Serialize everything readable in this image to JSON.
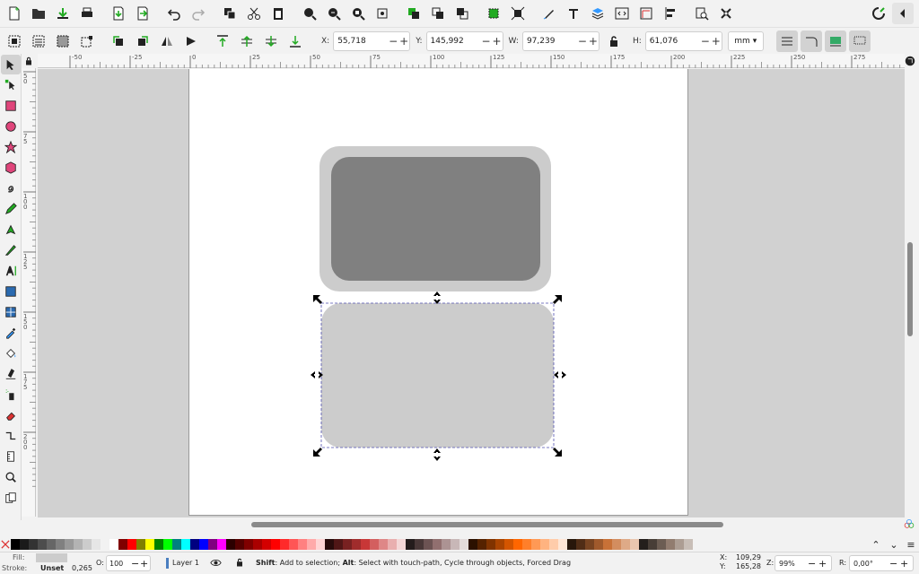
{
  "toolbar2": {
    "x_label": "X:",
    "x_value": "55,718",
    "y_label": "Y:",
    "y_value": "145,992",
    "w_label": "W:",
    "w_value": "97,239",
    "h_label": "H:",
    "h_value": "61,076",
    "unit": "mm"
  },
  "ruler": {
    "h_ticks": [
      "-50",
      "-25",
      "0",
      "25",
      "50",
      "75",
      "100",
      "125",
      "150",
      "175",
      "200",
      "225",
      "250",
      "275"
    ],
    "v_ticks": [
      "50",
      "75",
      "100",
      "125",
      "150",
      "175",
      "200"
    ]
  },
  "status": {
    "fill_label": "Fill:",
    "stroke_label": "Stroke:",
    "stroke_value": "Unset",
    "stroke_width": "0,265",
    "opacity_label": "O:",
    "opacity_value": "100",
    "layer": "Layer 1",
    "message_shift": "Shift",
    "message_1": ": Add to selection; ",
    "message_alt": "Alt",
    "message_2": ": Select with touch-path, Cycle through objects, Forced Drag",
    "cursor_x_label": "X:",
    "cursor_x": "109,29",
    "cursor_y_label": "Y:",
    "cursor_y": "165,28",
    "zoom_label": "Z:",
    "zoom": "99%",
    "rotation_label": "R:",
    "rotation": "0,00°"
  },
  "colors": {
    "accent_pink": "#e0457b",
    "dark_rect": "#808080",
    "light_rect": "#cccccc",
    "outer_rect": "#cccccc",
    "selection": "#5050b0"
  },
  "palette": [
    "#000000",
    "#1a1a1a",
    "#333333",
    "#4d4d4d",
    "#666666",
    "#808080",
    "#999999",
    "#b3b3b3",
    "#cccccc",
    "#e6e6e6",
    "#f2f2f2",
    "#ffffff",
    "#800000",
    "#ff0000",
    "#808000",
    "#ffff00",
    "#008000",
    "#00ff00",
    "#008080",
    "#00ffff",
    "#000080",
    "#0000ff",
    "#800080",
    "#ff00ff",
    "#2b0000",
    "#550000",
    "#800000",
    "#aa0000",
    "#d40000",
    "#ff0000",
    "#ff2a2a",
    "#ff5555",
    "#ff8080",
    "#ffaaaa",
    "#ffd5d5",
    "#280b0b",
    "#501616",
    "#782121",
    "#a02c2c",
    "#c83737",
    "#d35f5f",
    "#de8787",
    "#e9afaf",
    "#f4d7d7",
    "#241c1c",
    "#483737",
    "#6c5353",
    "#916f6f",
    "#ac9393",
    "#c8b7b7",
    "#e3dbdb",
    "#2b1100",
    "#552200",
    "#803300",
    "#aa4400",
    "#d45500",
    "#ff6600",
    "#ff7f2a",
    "#ff9955",
    "#ffb380",
    "#ffccaa",
    "#ffe6d5",
    "#28170b",
    "#502d16",
    "#784421",
    "#a05a2c",
    "#c87137",
    "#d38d5f",
    "#deaa87",
    "#e9c6af",
    "#241f1c",
    "#483e37",
    "#6c5d53",
    "#917c6f",
    "#ac9d93",
    "#c8beb7"
  ]
}
